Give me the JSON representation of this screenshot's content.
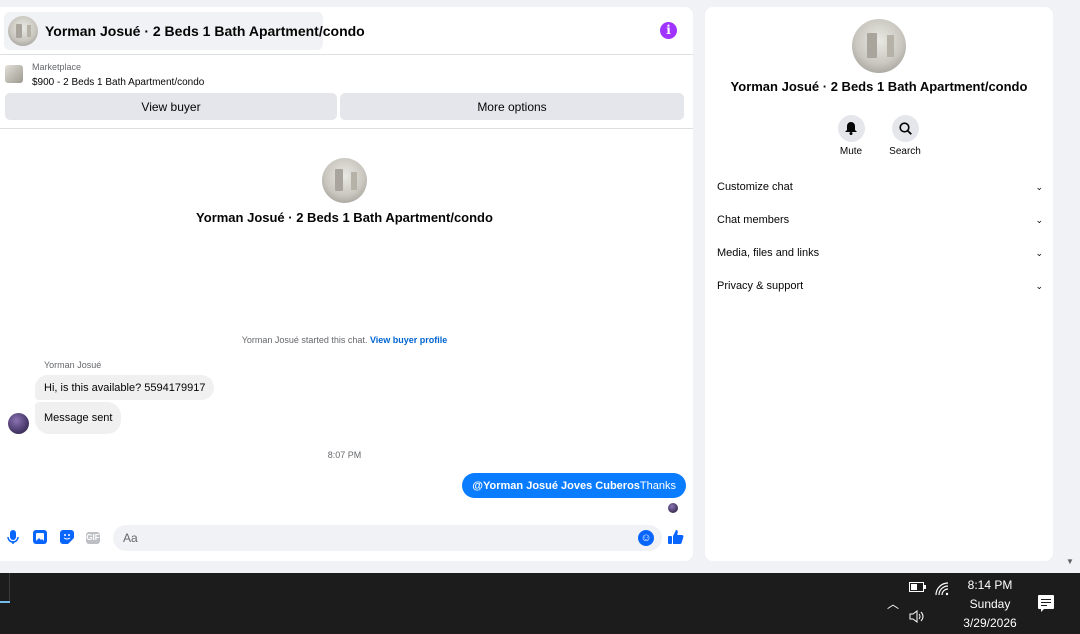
{
  "chat": {
    "header_title": "Yorman Josué · 2 Beds 1 Bath Apartment/condo",
    "info_icon": "i",
    "marketplace_label": "Marketplace",
    "listing": "$900 - 2 Beds 1 Bath Apartment/condo",
    "view_buyer_label": "View buyer",
    "more_options_label": "More options",
    "center_title": "Yorman Josué · 2 Beds 1 Bath Apartment/condo",
    "system_message": "Yorman Josué started this chat.",
    "system_link": "View buyer profile",
    "sender_name": "Yorman Josué",
    "messages_in": [
      "Hi, is this available? 5594179917",
      "Message sent"
    ],
    "timestamp": "8:07 PM",
    "message_out_mention": "@Yorman Josué Joves Cuberos",
    "message_out_text": "Thanks",
    "composer_placeholder": "Aa"
  },
  "info_panel": {
    "title": "Yorman Josué · 2 Beds 1 Bath Apartment/condo",
    "actions": [
      {
        "label": "Mute",
        "icon": "bell-icon"
      },
      {
        "label": "Search",
        "icon": "search-icon"
      }
    ],
    "menu": [
      "Customize chat",
      "Chat members",
      "Media, files and links",
      "Privacy & support"
    ]
  },
  "taskbar": {
    "time": "8:14 PM",
    "day": "Sunday",
    "date": "3/29/2026"
  },
  "colors": {
    "accent": "#0a7cff",
    "info_icon": "#a033ff",
    "bubble_in": "#f0f0f0",
    "taskbar": "#1c1c1c"
  }
}
